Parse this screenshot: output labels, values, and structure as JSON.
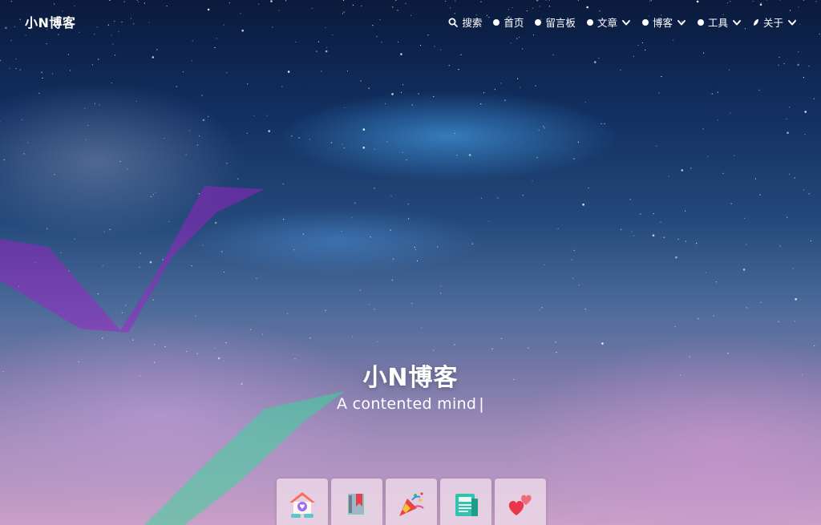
{
  "brand": {
    "name": "小N博客"
  },
  "nav": {
    "items": [
      {
        "label": "搜索",
        "icon": "search-icon",
        "has_dropdown": false
      },
      {
        "label": "首页",
        "icon": "home-dot-icon",
        "has_dropdown": false
      },
      {
        "label": "留言板",
        "icon": "message-dot-icon",
        "has_dropdown": false
      },
      {
        "label": "文章",
        "icon": "article-dot-icon",
        "has_dropdown": true
      },
      {
        "label": "博客",
        "icon": "blog-dot-icon",
        "has_dropdown": true
      },
      {
        "label": "工具",
        "icon": "tools-dot-icon",
        "has_dropdown": true
      },
      {
        "label": "关于",
        "icon": "about-leaf-icon",
        "has_dropdown": true
      }
    ]
  },
  "hero": {
    "title": "小N博客",
    "subtitle": "A contented mind",
    "cursor": "|"
  },
  "shortcuts": [
    {
      "icon": "home-heart-icon"
    },
    {
      "icon": "bookmark-book-icon"
    },
    {
      "icon": "party-popper-icon"
    },
    {
      "icon": "newspaper-icon"
    },
    {
      "icon": "hearts-icon"
    }
  ],
  "colors": {
    "sky_top": "#0a1a3c",
    "sky_bottom": "#c9a0c8",
    "ribbon_purple": "#a020c8",
    "ribbon_green": "#3ad69a",
    "tile_bg": "#f0dceb"
  }
}
